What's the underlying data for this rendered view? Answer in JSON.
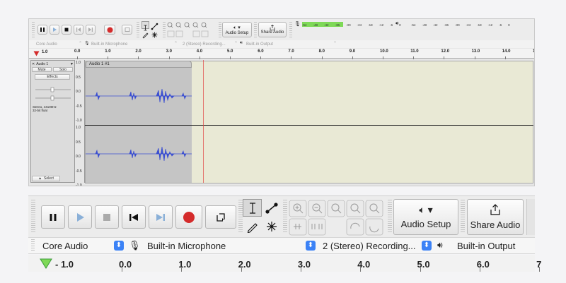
{
  "colors": {
    "record": "#d42b2b",
    "waveform": "#3b4fd1",
    "meter_green": "#7ed957",
    "playhead": "#3a9a3a",
    "cursor_line": "#e04040",
    "chevron": "#3b82f6"
  },
  "top": {
    "transport_icons": [
      "pause-icon",
      "play-icon",
      "stop-icon",
      "skip-start-icon",
      "skip-end-icon",
      "record-icon",
      "loop-icon"
    ],
    "tools_icons": [
      "select-tool-icon",
      "envelope-tool-icon",
      "draw-tool-icon",
      "multi-tool-icon"
    ],
    "audio_setup_label": "Audio Setup",
    "share_audio_label": "Share Audio",
    "meter_ticks": [
      "-54",
      "-48",
      "-42",
      "-36",
      "-30",
      "-24",
      "-18",
      "-12",
      "-6",
      "0"
    ],
    "host": "Core Audio",
    "input_device": "Built-in Microphone",
    "channels": "2 (Stereo) Recording...",
    "output_device": "Built-in Output",
    "ruler_left": "1.0",
    "ruler_labels": [
      "0.0",
      "1.0",
      "2.0",
      "3.0",
      "4.0",
      "5.0",
      "6.0",
      "7.0",
      "8.0",
      "9.0",
      "10.0",
      "11.0",
      "12.0",
      "13.0",
      "14.0",
      "15."
    ],
    "track": {
      "name": "Audio 1",
      "clip_name": "Audio 1 #1",
      "mute": "Mute",
      "solo": "Solo",
      "effects": "Effects",
      "gain_minus": "-",
      "gain_plus": "+",
      "pan_l": "L",
      "pan_r": "R",
      "info_line1": "Stereo, 44100Hz",
      "info_line2": "32-bit float",
      "select": "Select",
      "scale": [
        "1.0",
        "0.5",
        "0.0",
        "-0.5",
        "-1.0"
      ]
    }
  },
  "bottom": {
    "audio_setup_label": "Audio Setup",
    "share_audio_label": "Share Audio",
    "host": "Core Audio",
    "input_device": "Built-in Microphone",
    "channels": "2 (Stereo) Recording...",
    "output_device": "Built-in Output",
    "ruler_left": "1.0",
    "ruler_labels": [
      "0.0",
      "1.0",
      "2.0",
      "3.0",
      "4.0",
      "5.0",
      "6.0",
      "7"
    ]
  }
}
